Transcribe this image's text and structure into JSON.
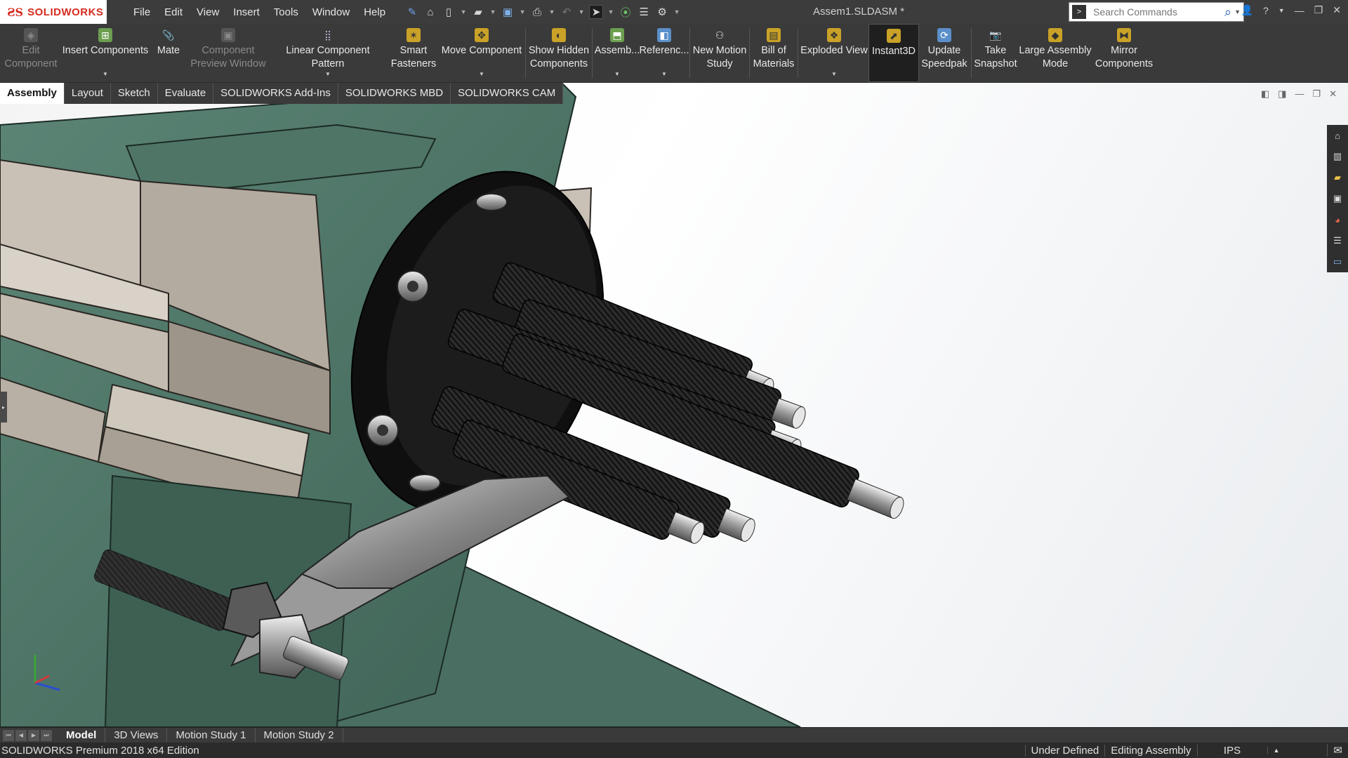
{
  "app": {
    "logo_text": "SOLIDWORKS",
    "document_title": "Assem1.SLDASM *"
  },
  "menu": {
    "items": [
      "File",
      "Edit",
      "View",
      "Insert",
      "Tools",
      "Window",
      "Help"
    ]
  },
  "quick_access_icons": [
    "pin-icon",
    "home-icon",
    "new-document-icon",
    "open-icon",
    "save-icon",
    "print-icon",
    "undo-icon",
    "select-icon",
    "traffic-light-icon",
    "options-list-icon",
    "gear-icon"
  ],
  "search": {
    "placeholder": "Search Commands"
  },
  "ribbon": {
    "commands": [
      {
        "label1": "Edit",
        "label2": "Component",
        "icon": "edit-component-icon",
        "disabled": true
      },
      {
        "label1": "Insert Components",
        "label2": "",
        "icon": "insert-components-icon",
        "caret": true
      },
      {
        "label1": "Mate",
        "label2": "",
        "icon": "mate-icon"
      },
      {
        "label1": "Component",
        "label2": "Preview Window",
        "icon": "preview-window-icon",
        "disabled": true
      },
      {
        "label1": "Linear Component Pattern",
        "label2": "",
        "icon": "linear-pattern-icon",
        "caret": true
      },
      {
        "label1": "Smart",
        "label2": "Fasteners",
        "icon": "smart-fasteners-icon"
      },
      {
        "label1": "Move Component",
        "label2": "",
        "icon": "move-component-icon",
        "caret": true
      },
      {
        "label1": "Show Hidden",
        "label2": "Components",
        "icon": "show-hidden-icon"
      },
      {
        "label1": "Assemb...",
        "label2": "",
        "icon": "assembly-features-icon",
        "caret": true
      },
      {
        "label1": "Referenc...",
        "label2": "",
        "icon": "reference-geometry-icon",
        "caret": true
      },
      {
        "label1": "New Motion",
        "label2": "Study",
        "icon": "motion-study-icon"
      },
      {
        "label1": "Bill of",
        "label2": "Materials",
        "icon": "bom-icon"
      },
      {
        "label1": "Exploded View",
        "label2": "",
        "icon": "exploded-view-icon",
        "caret": true
      },
      {
        "label1": "Instant3D",
        "label2": "",
        "icon": "instant3d-icon",
        "active": true
      },
      {
        "label1": "Update",
        "label2": "Speedpak",
        "icon": "speedpak-icon"
      },
      {
        "label1": "Take",
        "label2": "Snapshot",
        "icon": "camera-icon"
      },
      {
        "label1": "Large Assembly",
        "label2": "Mode",
        "icon": "large-assembly-icon"
      },
      {
        "label1": "Mirror",
        "label2": "Components",
        "icon": "mirror-icon"
      }
    ]
  },
  "tabs": [
    "Assembly",
    "Layout",
    "Sketch",
    "Evaluate",
    "SOLIDWORKS Add-Ins",
    "SOLIDWORKS MBD",
    "SOLIDWORKS CAM"
  ],
  "active_tab": "Assembly",
  "bottom_tabs": [
    "Model",
    "3D Views",
    "Motion Study 1",
    "Motion Study 2"
  ],
  "active_bottom_tab": "Model",
  "status": {
    "edition": "SOLIDWORKS Premium 2018 x64 Edition",
    "definition": "Under Defined",
    "mode": "Editing Assembly",
    "units": "IPS"
  },
  "colors": {
    "brand": "#d52b1e",
    "ui_dark": "#3a3a3a",
    "part_green": "#4f7567",
    "flange_black": "#141414"
  }
}
